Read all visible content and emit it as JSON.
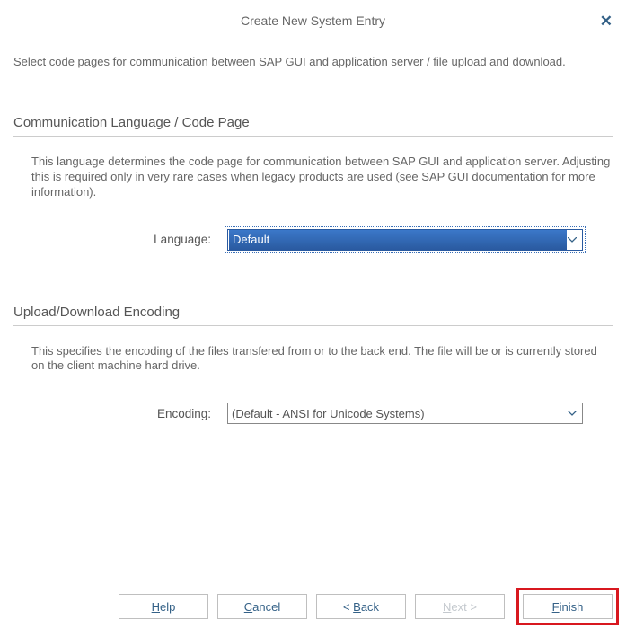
{
  "dialog": {
    "title": "Create New System Entry",
    "intro": "Select code pages for communication between SAP GUI and application server / file upload and download."
  },
  "section1": {
    "header": "Communication Language / Code Page",
    "desc": "This language determines the code page for communication between SAP GUI and application server. Adjusting this is required only in very rare cases when legacy products are used (see SAP GUI documentation for more information).",
    "label": "Language:",
    "value": "Default"
  },
  "section2": {
    "header": "Upload/Download Encoding",
    "desc": "This specifies the encoding of the files transfered from or to the back end. The file will be or is currently stored on the client machine hard drive.",
    "label": "Encoding:",
    "value": "(Default - ANSI for Unicode Systems)"
  },
  "buttons": {
    "help_pre": "H",
    "help_post": "elp",
    "cancel_pre": "C",
    "cancel_post": "ancel",
    "back_pre": "< ",
    "back_u": "B",
    "back_post": "ack",
    "next_pre": "N",
    "next_post": "ext >",
    "finish_pre": "F",
    "finish_post": "inish"
  }
}
